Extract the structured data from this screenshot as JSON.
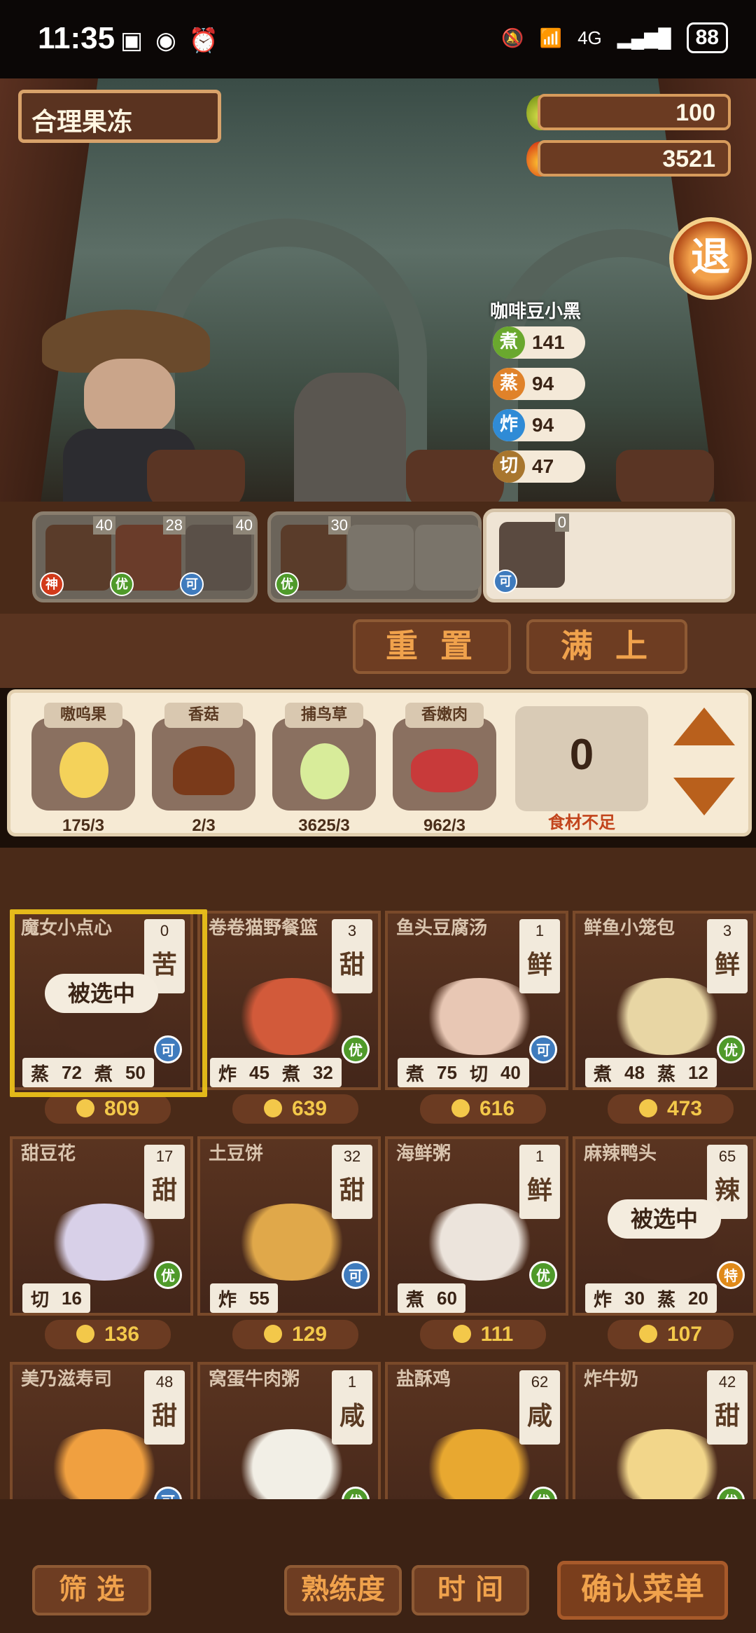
{
  "status_bar": {
    "time": "11:35",
    "network": "4G",
    "battery": "88"
  },
  "header": {
    "title": "合理果冻",
    "resources": [
      {
        "name": "potion",
        "value": "100"
      },
      {
        "name": "fire",
        "value": "3521"
      }
    ],
    "exit_label": "退"
  },
  "npc": {
    "name": "咖啡豆小黑",
    "stats": [
      {
        "label": "煮",
        "value": "141",
        "color": "#6aa82e"
      },
      {
        "label": "蒸",
        "value": "94",
        "color": "#e0822a"
      },
      {
        "label": "炸",
        "value": "94",
        "color": "#2f8bd6"
      },
      {
        "label": "切",
        "value": "47",
        "color": "#a8762e"
      }
    ]
  },
  "slots": {
    "group1": [
      {
        "num": "40",
        "grade": "神"
      },
      {
        "num": "28",
        "grade": "优"
      },
      {
        "num": "40",
        "grade": "可"
      }
    ],
    "group2": [
      {
        "num": "30",
        "grade": "优"
      }
    ],
    "selected": {
      "num": "0",
      "grade": "可"
    }
  },
  "buttons": {
    "reset": "重 置",
    "fill": "满 上"
  },
  "ingredients": [
    {
      "name": "嗷呜果",
      "count": "175/3"
    },
    {
      "name": "香菇",
      "count": "2/3"
    },
    {
      "name": "捕鸟草",
      "count": "3625/3"
    },
    {
      "name": "香嫩肉",
      "count": "962/3"
    }
  ],
  "quantity": {
    "value": "0",
    "note": "食材不足"
  },
  "dishes": [
    {
      "name": "魔女小点心",
      "level": "0",
      "flavor": "苦",
      "grade": "可",
      "grade_color": "#3f7bbd",
      "req": [
        [
          "蒸",
          "72"
        ],
        [
          "煮",
          "50"
        ]
      ],
      "price": "809",
      "selected": "被选中",
      "food_color": "#4a2a1c"
    },
    {
      "name": "卷卷猫野餐篮",
      "level": "3",
      "flavor": "甜",
      "grade": "优",
      "grade_color": "#4f9a2a",
      "req": [
        [
          "炸",
          "45"
        ],
        [
          "煮",
          "32"
        ]
      ],
      "price": "639",
      "food_color": "#d25a3a"
    },
    {
      "name": "鱼头豆腐汤",
      "level": "1",
      "flavor": "鲜",
      "grade": "可",
      "grade_color": "#3f7bbd",
      "req": [
        [
          "煮",
          "75"
        ],
        [
          "切",
          "40"
        ]
      ],
      "price": "616",
      "food_color": "#e8c7b4"
    },
    {
      "name": "鲜鱼小笼包",
      "level": "3",
      "flavor": "鲜",
      "grade": "优",
      "grade_color": "#4f9a2a",
      "req": [
        [
          "煮",
          "48"
        ],
        [
          "蒸",
          "12"
        ]
      ],
      "price": "473",
      "food_color": "#e8d6a4"
    },
    {
      "name": "甜豆花",
      "level": "17",
      "flavor": "甜",
      "grade": "优",
      "grade_color": "#4f9a2a",
      "req": [
        [
          "切",
          "16"
        ]
      ],
      "price": "136",
      "food_color": "#d8d0e8"
    },
    {
      "name": "土豆饼",
      "level": "32",
      "flavor": "甜",
      "grade": "可",
      "grade_color": "#3f7bbd",
      "req": [
        [
          "炸",
          "55"
        ]
      ],
      "price": "129",
      "food_color": "#e0a84a"
    },
    {
      "name": "海鲜粥",
      "level": "1",
      "flavor": "鲜",
      "grade": "优",
      "grade_color": "#4f9a2a",
      "req": [
        [
          "煮",
          "60"
        ]
      ],
      "price": "111",
      "food_color": "#ece4dc"
    },
    {
      "name": "麻辣鸭头",
      "level": "65",
      "flavor": "辣",
      "grade": "特",
      "grade_color": "#e08a1a",
      "req": [
        [
          "炸",
          "30"
        ],
        [
          "蒸",
          "20"
        ]
      ],
      "price": "107",
      "selected": "被选中",
      "food_color": "#4a2a1c"
    },
    {
      "name": "美乃滋寿司",
      "level": "48",
      "flavor": "甜",
      "grade": "可",
      "grade_color": "#3f7bbd",
      "req": [],
      "price": "",
      "food_color": "#f0a040"
    },
    {
      "name": "窝蛋牛肉粥",
      "level": "1",
      "flavor": "咸",
      "grade": "优",
      "grade_color": "#4f9a2a",
      "req": [],
      "price": "",
      "food_color": "#f2efe6"
    },
    {
      "name": "盐酥鸡",
      "level": "62",
      "flavor": "咸",
      "grade": "优",
      "grade_color": "#4f9a2a",
      "req": [],
      "price": "",
      "food_color": "#e8a830"
    },
    {
      "name": "炸牛奶",
      "level": "42",
      "flavor": "甜",
      "grade": "优",
      "grade_color": "#4f9a2a",
      "req": [],
      "price": "",
      "food_color": "#f2d68a"
    }
  ],
  "bottom": {
    "filter": "筛 选",
    "proficiency": "熟练度",
    "time": "时 间",
    "confirm": "确认菜单"
  }
}
